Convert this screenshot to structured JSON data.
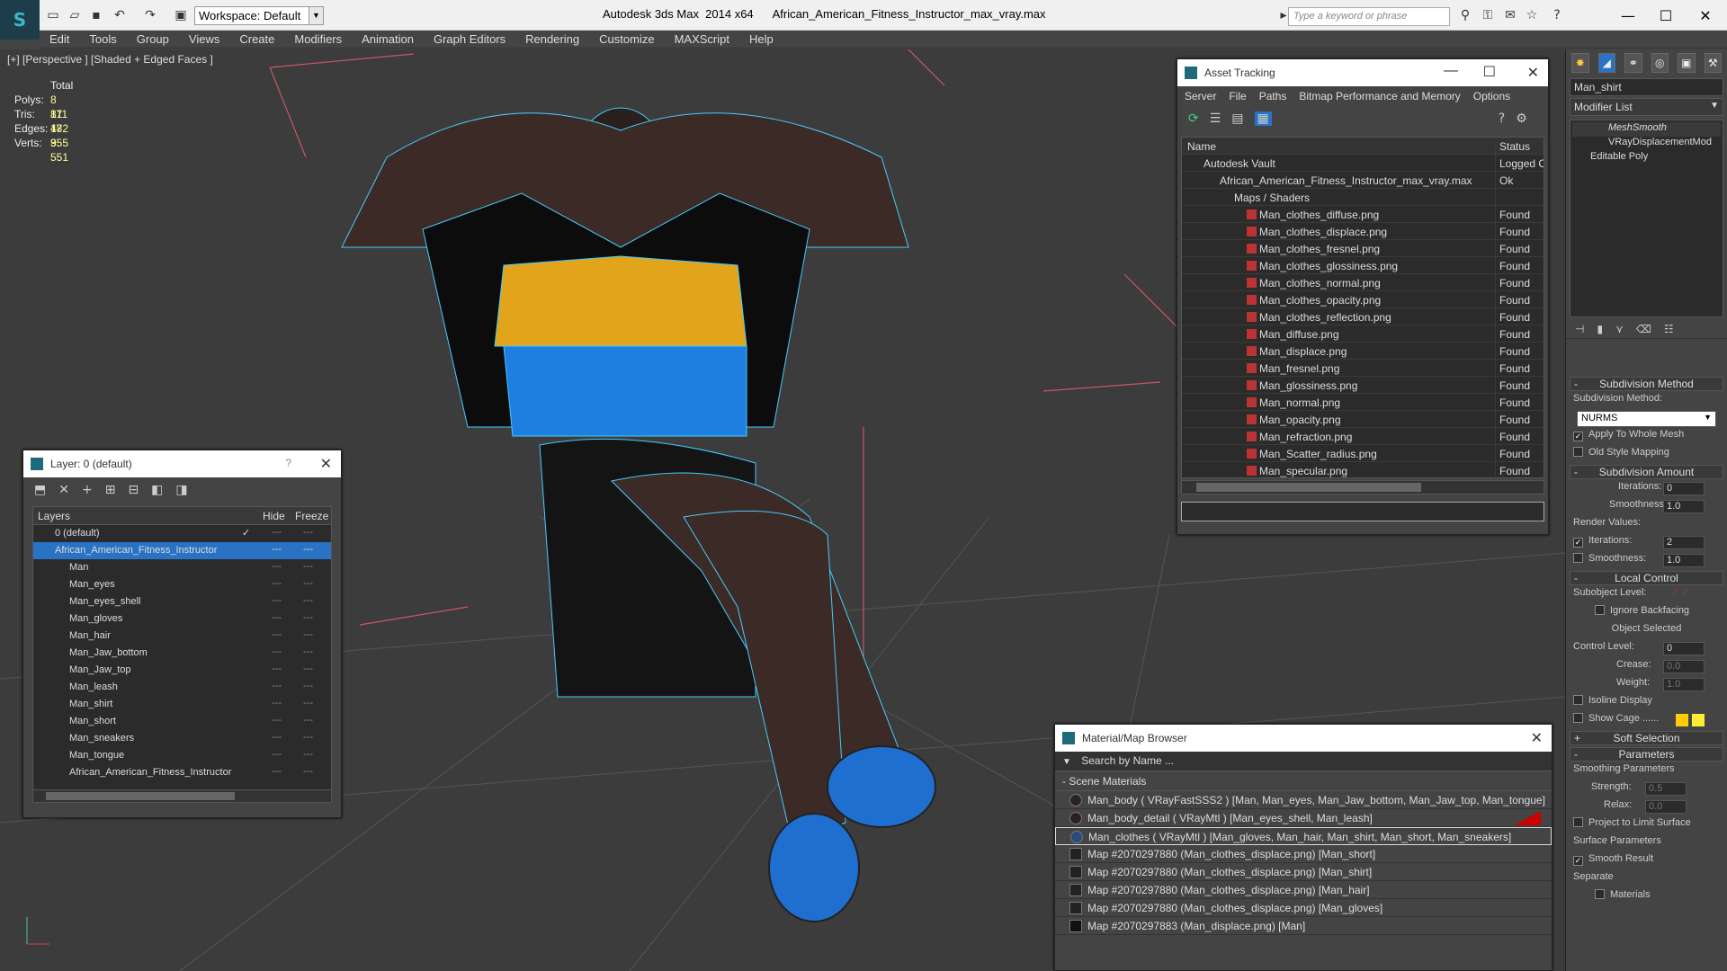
{
  "app": {
    "title": "Autodesk 3ds Max  2014 x64      African_American_Fitness_Instructor_max_vray.max",
    "workspace": "Workspace: Default",
    "search_placeholder": "Type a keyword or phrase"
  },
  "menu": [
    "Edit",
    "Tools",
    "Group",
    "Views",
    "Create",
    "Modifiers",
    "Animation",
    "Graph Editors",
    "Rendering",
    "Customize",
    "MAXScript",
    "Help"
  ],
  "viewport": {
    "label": "[+] [Perspective ] [Shaded + Edged Faces ]",
    "stats_header": "Total",
    "stats": [
      {
        "k": "Polys:",
        "v": "8 811"
      },
      {
        "k": "Tris:",
        "v": "17 472"
      },
      {
        "k": "Edges:",
        "v": "18 355"
      },
      {
        "k": "Verts:",
        "v": "9 551"
      }
    ]
  },
  "layer_window": {
    "title": "Layer: 0 (default)",
    "help": "?",
    "col_layers": "Layers",
    "col_hide": "Hide",
    "col_freeze": "Freeze",
    "rows": [
      "0 (default)",
      "African_American_Fitness_Instructor",
      "Man",
      "Man_eyes",
      "Man_eyes_shell",
      "Man_gloves",
      "Man_hair",
      "Man_Jaw_bottom",
      "Man_Jaw_top",
      "Man_leash",
      "Man_shirt",
      "Man_short",
      "Man_sneakers",
      "Man_tongue",
      "African_American_Fitness_Instructor"
    ]
  },
  "asset_window": {
    "title": "Asset Tracking",
    "menu": [
      "Server",
      "File",
      "Paths",
      "Bitmap Performance and Memory",
      "Options"
    ],
    "col_name": "Name",
    "col_status": "Status",
    "rows": [
      {
        "name": "Autodesk Vault",
        "status": "Logged Ou",
        "indent": 0
      },
      {
        "name": "African_American_Fitness_Instructor_max_vray.max",
        "status": "Ok",
        "indent": 1
      },
      {
        "name": "Maps / Shaders",
        "status": "",
        "indent": 2
      },
      {
        "name": "Man_clothes_diffuse.png",
        "status": "Found",
        "indent": 3
      },
      {
        "name": "Man_clothes_displace.png",
        "status": "Found",
        "indent": 3
      },
      {
        "name": "Man_clothes_fresnel.png",
        "status": "Found",
        "indent": 3
      },
      {
        "name": "Man_clothes_glossiness.png",
        "status": "Found",
        "indent": 3
      },
      {
        "name": "Man_clothes_normal.png",
        "status": "Found",
        "indent": 3
      },
      {
        "name": "Man_clothes_opacity.png",
        "status": "Found",
        "indent": 3
      },
      {
        "name": "Man_clothes_reflection.png",
        "status": "Found",
        "indent": 3
      },
      {
        "name": "Man_diffuse.png",
        "status": "Found",
        "indent": 3
      },
      {
        "name": "Man_displace.png",
        "status": "Found",
        "indent": 3
      },
      {
        "name": "Man_fresnel.png",
        "status": "Found",
        "indent": 3
      },
      {
        "name": "Man_glossiness.png",
        "status": "Found",
        "indent": 3
      },
      {
        "name": "Man_normal.png",
        "status": "Found",
        "indent": 3
      },
      {
        "name": "Man_opacity.png",
        "status": "Found",
        "indent": 3
      },
      {
        "name": "Man_refraction.png",
        "status": "Found",
        "indent": 3
      },
      {
        "name": "Man_Scatter_radius.png",
        "status": "Found",
        "indent": 3
      },
      {
        "name": "Man_specular.png",
        "status": "Found",
        "indent": 3
      }
    ]
  },
  "mat_browser": {
    "title": "Material/Map Browser",
    "search": "Search by Name ...",
    "section": "- Scene Materials",
    "rows": [
      "Man_body  ( VRayFastSSS2 ) [Man, Man_eyes, Man_Jaw_bottom, Man_Jaw_top, Man_tongue]",
      "Man_body_detail  ( VRayMtl ) [Man_eyes_shell, Man_leash]",
      "Man_clothes  ( VRayMtl ) [Man_gloves, Man_hair, Man_shirt, Man_short, Man_sneakers]",
      "Map #2070297880 (Man_clothes_displace.png)  [Man_short]",
      "Map #2070297880 (Man_clothes_displace.png)  [Man_shirt]",
      "Map #2070297880 (Man_clothes_displace.png)  [Man_hair]",
      "Map #2070297880 (Man_clothes_displace.png)  [Man_gloves]",
      "Map #2070297883 (Man_displace.png)  [Man]"
    ]
  },
  "cmd": {
    "object_name": "Man_shirt",
    "modifier_list": "Modifier List",
    "stack": [
      "MeshSmooth",
      "VRayDisplacementMod",
      "Editable Poly"
    ],
    "subdiv_method_title": "Subdivision Method",
    "subdiv_method_label": "Subdivision Method:",
    "subdiv_method": "NURMS",
    "apply_whole": "Apply To Whole Mesh",
    "old_style": "Old Style Mapping",
    "subdiv_amount_title": "Subdivision Amount",
    "iterations_label": "Iterations:",
    "iterations": "0",
    "smoothness_label": "Smoothness:",
    "smoothness": "1.0",
    "render_values": "Render Values:",
    "r_iterations": "2",
    "r_smoothness": "1.0",
    "local_title": "Local Control",
    "subobject_label": "Subobject Level:",
    "ignore_backfacing": "Ignore Backfacing",
    "object_selected": "Object Selected",
    "control_level_label": "Control Level:",
    "control_level": "0",
    "crease_label": "Crease:",
    "crease": "0.0",
    "weight_label": "Weight:",
    "weight": "1.0",
    "isoline": "Isoline Display",
    "show_cage": "Show Cage ......",
    "soft_sel": "Soft Selection",
    "params": "Parameters",
    "smoothing_params": "Smoothing Parameters",
    "strength_label": "Strength:",
    "strength": "0.5",
    "relax_label": "Relax:",
    "relax": "0.0",
    "project": "Project to Limit Surface",
    "surface_params": "Surface Parameters",
    "smooth_result": "Smooth Result",
    "separate": "Separate",
    "materials": "Materials"
  }
}
